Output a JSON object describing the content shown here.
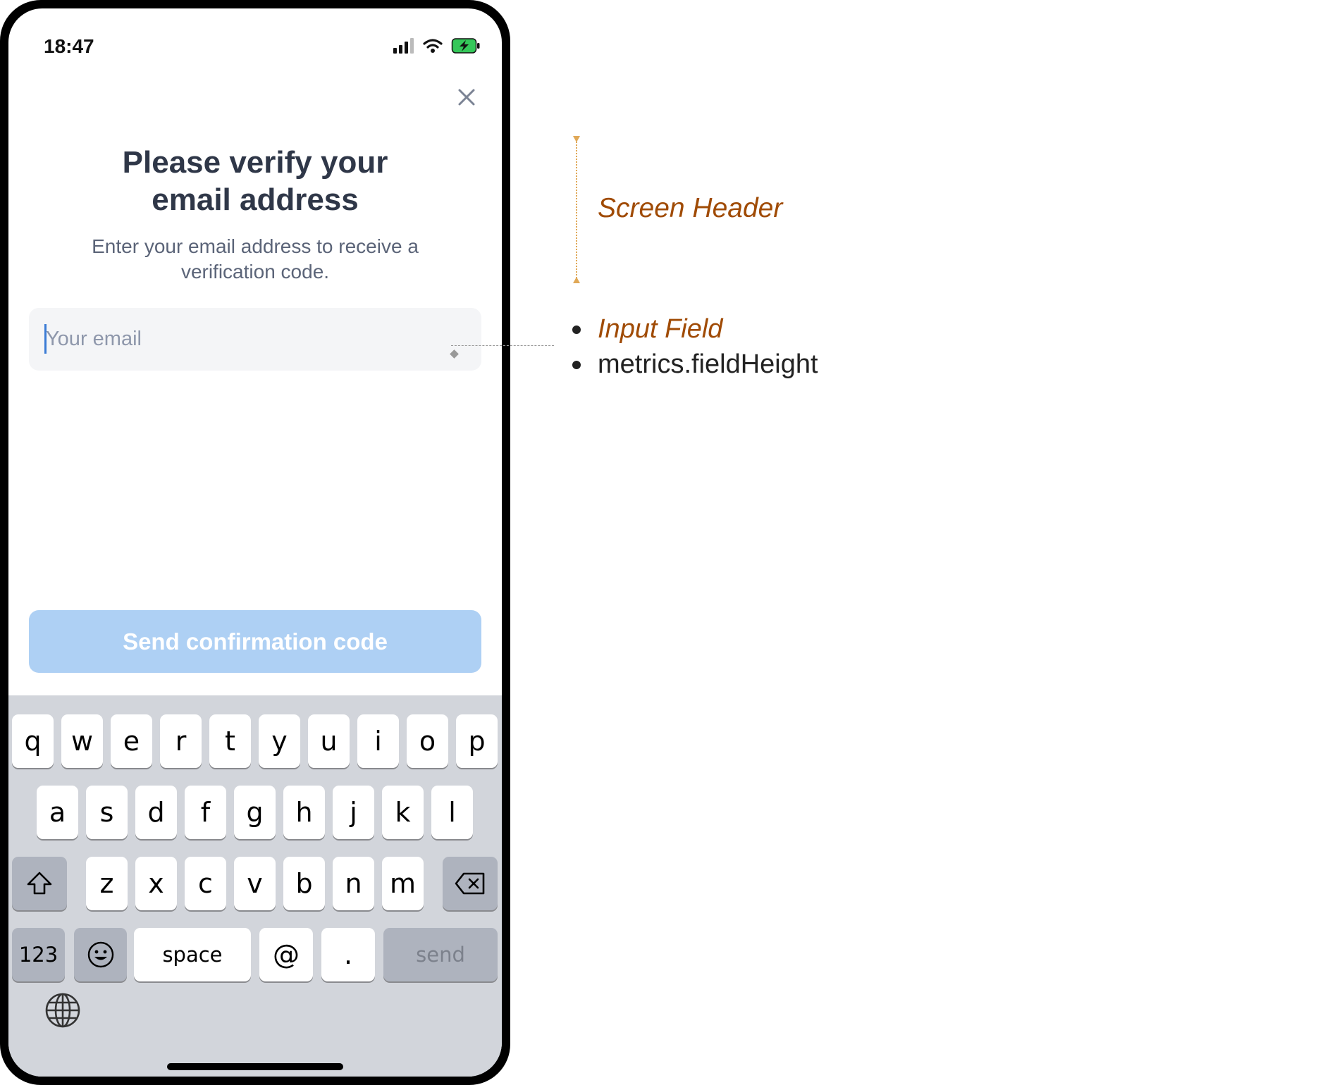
{
  "status_bar": {
    "time": "18:47",
    "icons": [
      "signal-icon",
      "wifi-icon",
      "battery-charging-icon"
    ]
  },
  "header": {
    "title_line1": "Please verify your",
    "title_line2": "email address",
    "subtitle_line1": "Enter your email address to receive a",
    "subtitle_line2": "verification code."
  },
  "email_field": {
    "value": "",
    "placeholder": "Your email"
  },
  "send_button": {
    "label": "Send confirmation code",
    "state": "disabled"
  },
  "keyboard": {
    "row1": [
      "q",
      "w",
      "e",
      "r",
      "t",
      "y",
      "u",
      "i",
      "o",
      "p"
    ],
    "row2": [
      "a",
      "s",
      "d",
      "f",
      "g",
      "h",
      "j",
      "k",
      "l"
    ],
    "row3": [
      "z",
      "x",
      "c",
      "v",
      "b",
      "n",
      "m"
    ],
    "numbers_label": "123",
    "space_label": "space",
    "at_label": "@",
    "dot_label": ".",
    "send_label": "send"
  },
  "annotations": {
    "screen_header": "Screen Header",
    "input_field": "Input Field",
    "field_metric": "metrics.fieldHeight"
  },
  "colors": {
    "accent": "#aed0f4",
    "title_text": "#2f3748",
    "annotation": "#a04b05",
    "bracket": "#e0a857",
    "keyboard_bg": "#d2d5db"
  }
}
